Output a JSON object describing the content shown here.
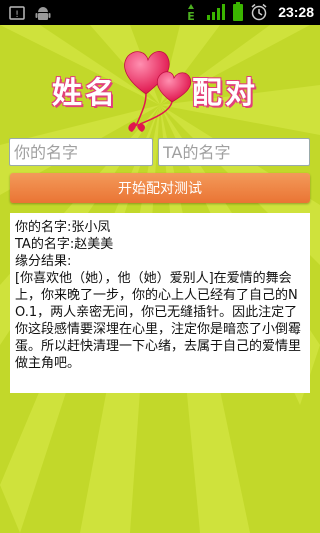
{
  "status_bar": {
    "time": "23:28",
    "network_label": "E",
    "icons": [
      "notification-icon",
      "android-icon",
      "data-arrows-icon",
      "signal-icon",
      "battery-icon",
      "alarm-icon"
    ]
  },
  "header": {
    "title_left": "姓名",
    "title_right": "配对",
    "logo": "hearts-icon"
  },
  "inputs": {
    "your_name": {
      "value": "",
      "placeholder": "你的名字"
    },
    "ta_name": {
      "value": "",
      "placeholder": "TA的名字"
    }
  },
  "start_button": {
    "label": "开始配对测试"
  },
  "result": {
    "your_name_label": "你的名字:",
    "your_name_value": "张小凤",
    "ta_name_label": "TA的名字:",
    "ta_name_value": "赵美美",
    "result_label": "缘分结果:",
    "result_text": "[你喜欢他（她），他（她）爱别人]在爱情的舞会上，你来晚了一步，你的心上人已经有了自己的NO.1，两人亲密无间，你已无缝插针。因此注定了你这段感情要深埋在心里，注定你是暗恋了小倒霉蛋。所以赶快清理一下心绪，去属于自己的爱情里做主角吧。"
  },
  "colors": {
    "background": "#c2d82a",
    "button": "#ea7434",
    "title_outline": "#e2407a"
  }
}
